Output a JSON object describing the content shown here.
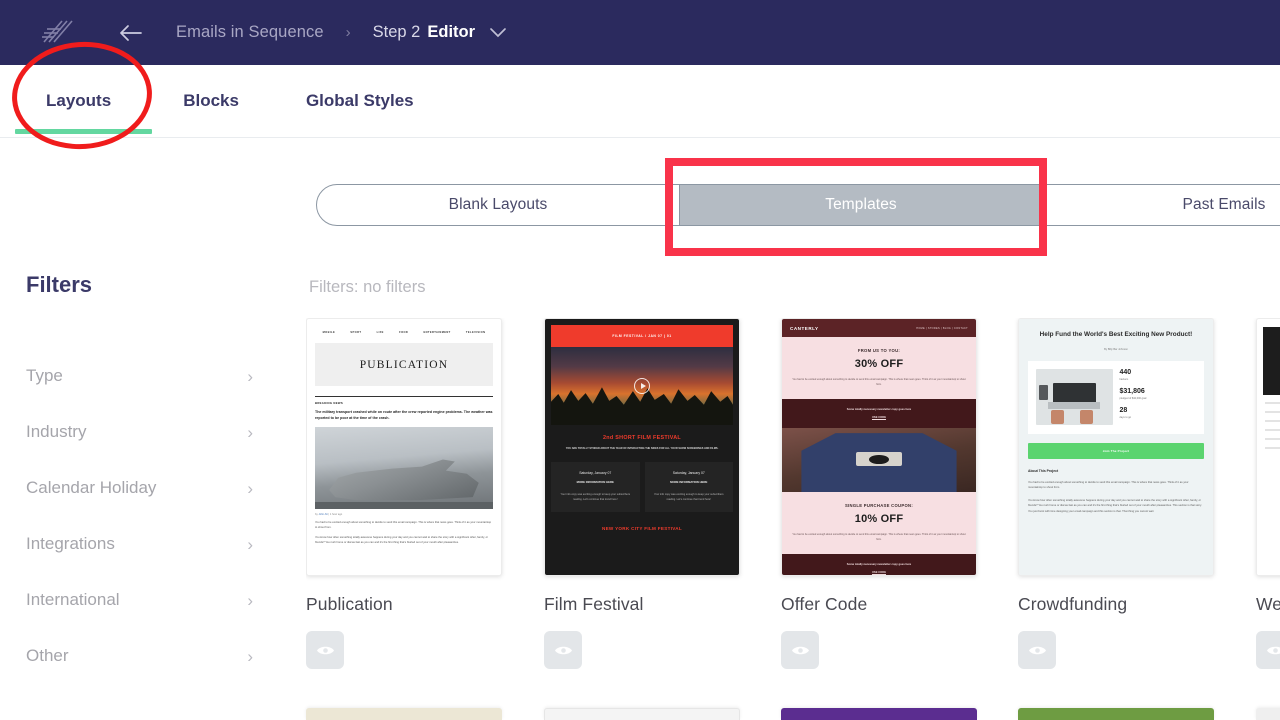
{
  "colors": {
    "header_navy": "#2b2a5e",
    "tab_underline_green": "#63d7a0",
    "annotation_red": "#f01c1c",
    "annotation_rect_red": "#f9334a",
    "segment_selected_gray": "#b4bbc3"
  },
  "header": {
    "logo_icon": "slash-lines-logo",
    "back_icon": "arrow-left-icon",
    "breadcrumb_parent": "Emails in Sequence",
    "breadcrumb_separator": "›",
    "breadcrumb_step": "Step 2",
    "breadcrumb_current": "Editor",
    "caret_icon": "chevron-down-icon"
  },
  "tabs": {
    "items": [
      {
        "label": "Layouts",
        "active": true
      },
      {
        "label": "Blocks",
        "active": false
      },
      {
        "label": "Global Styles",
        "active": false
      }
    ]
  },
  "segmented": {
    "items": [
      {
        "label": "Blank Layouts",
        "selected": false
      },
      {
        "label": "Templates",
        "selected": true
      },
      {
        "label": "Past Emails",
        "selected": false
      }
    ]
  },
  "sidebar": {
    "title": "Filters",
    "chevron_icon": "chevron-right-icon",
    "items": [
      {
        "label": "Type"
      },
      {
        "label": "Industry"
      },
      {
        "label": "Calendar Holiday"
      },
      {
        "label": "Integrations"
      },
      {
        "label": "International"
      },
      {
        "label": "Other"
      }
    ]
  },
  "content": {
    "filters_status": "Filters: no filters",
    "preview_icon": "eye-icon"
  },
  "cards": [
    {
      "title": "Publication",
      "nav": [
        "MOBILE",
        "SPORT",
        "LIFE",
        "FOOD",
        "ENTERTAINMENT",
        "TELEVISION"
      ],
      "masthead": "PUBLICATION",
      "kicker": "BREAKING NEWS",
      "lead": "The military transport crashed while on route after the crew reported engine problems. The weather was reported to be poor at the time of the crash.",
      "byline_prefix": "by",
      "byline_author": "John Alt",
      "byline_time": "1 hour ago",
      "body1": "You had to be excited enough about something to decide to send this email campaign. This is where that news goes. Think of it as your mountaintop to shout from.",
      "body2": "You know how often something totally awesome happens during your day and you cannot wait to share the story with a significant other, family, or friends? You rush home or dial as fast as you can and it's the first thing that's blurted out of your mouth after pleasantries."
    },
    {
      "title": "Film Festival",
      "header": "FILM FESTIVAL / JAN 07 | 01",
      "play_icon": "play-circle-icon",
      "heading": "2nd SHORT FILM FESTIVAL",
      "subtext": "YOU ARE TOTALLY STOKED ABOUT THE YEAR OF INTERACTING THE SIDES FOR ALL YOUR SHOW SCREENINGS AND FILMS.",
      "columns": [
        {
          "date": "Saturday, January 07",
          "meta": "MORE INFORMATION HERE",
          "body": "Your info copy was exciting enough to keep your subscribers reading. Let's continue that trend here!"
        },
        {
          "date": "Saturday, January 07",
          "meta": "MORE INFORMATION HERE",
          "body": "Your info copy was exciting enough to keep your subscribers reading. Let's continue that trend here!"
        }
      ],
      "footer": "NEW YORK CITY FILM FESTIVAL"
    },
    {
      "title": "Offer Code",
      "brand": "CANTERLY",
      "nav": "HOME  |  STORES  |  BLOG  |  CONTACT",
      "offer1_label": "FROM US TO YOU:",
      "offer1_value": "30% OFF",
      "offer1_body": "You had to be excited enough about something to decide to send this email campaign. This is where that news goes. Think of it as your mountaintop to shout from.",
      "band1_text": "Some totally necessary newsletter copy goes here",
      "band1_cta": "USE CODE",
      "offer2_label": "SINGLE PURCHASE COUPON:",
      "offer2_value": "10% OFF",
      "offer2_body": "You had to be excited enough about something to decide to send this email campaign. This is where that news goes. Think of it as your mountaintop to shout from.",
      "band2_text": "Some totally necessary newsletter copy goes here",
      "band2_cta": "USE CODE"
    },
    {
      "title": "Crowdfunding",
      "heading": "Help Fund the World's Best Exciting New Product!",
      "byline": "By Billy Bar Johnson",
      "stats": [
        {
          "value": "440",
          "label": "backers"
        },
        {
          "value": "$31,806",
          "label": "pledged of $42,000 goal"
        },
        {
          "value": "28",
          "label": "days to go"
        }
      ],
      "cta": "Join The Project",
      "about_heading": "About This Project",
      "about_p1": "You had to be excited enough about something to decide to send this email campaign. This is where that news goes. Think of it as your mountaintop to shout from.",
      "about_p2": "You know how often something totally awesome happens during your day and you cannot wait to share the story with a significant other, family, or friends? You rush home or dial as fast as you can and it's the first thing that's blurted out of your mouth after pleasantries. This section is that story. You just burst with time designing your email campaign and this section is that. That thing you cannot wait"
    },
    {
      "title": "We"
    }
  ],
  "row2_cards": [
    {
      "color": "#ece7d5"
    },
    {
      "color": "#f2f2f2"
    },
    {
      "color": "#5b2d90"
    },
    {
      "color": "#6e9c42"
    }
  ]
}
